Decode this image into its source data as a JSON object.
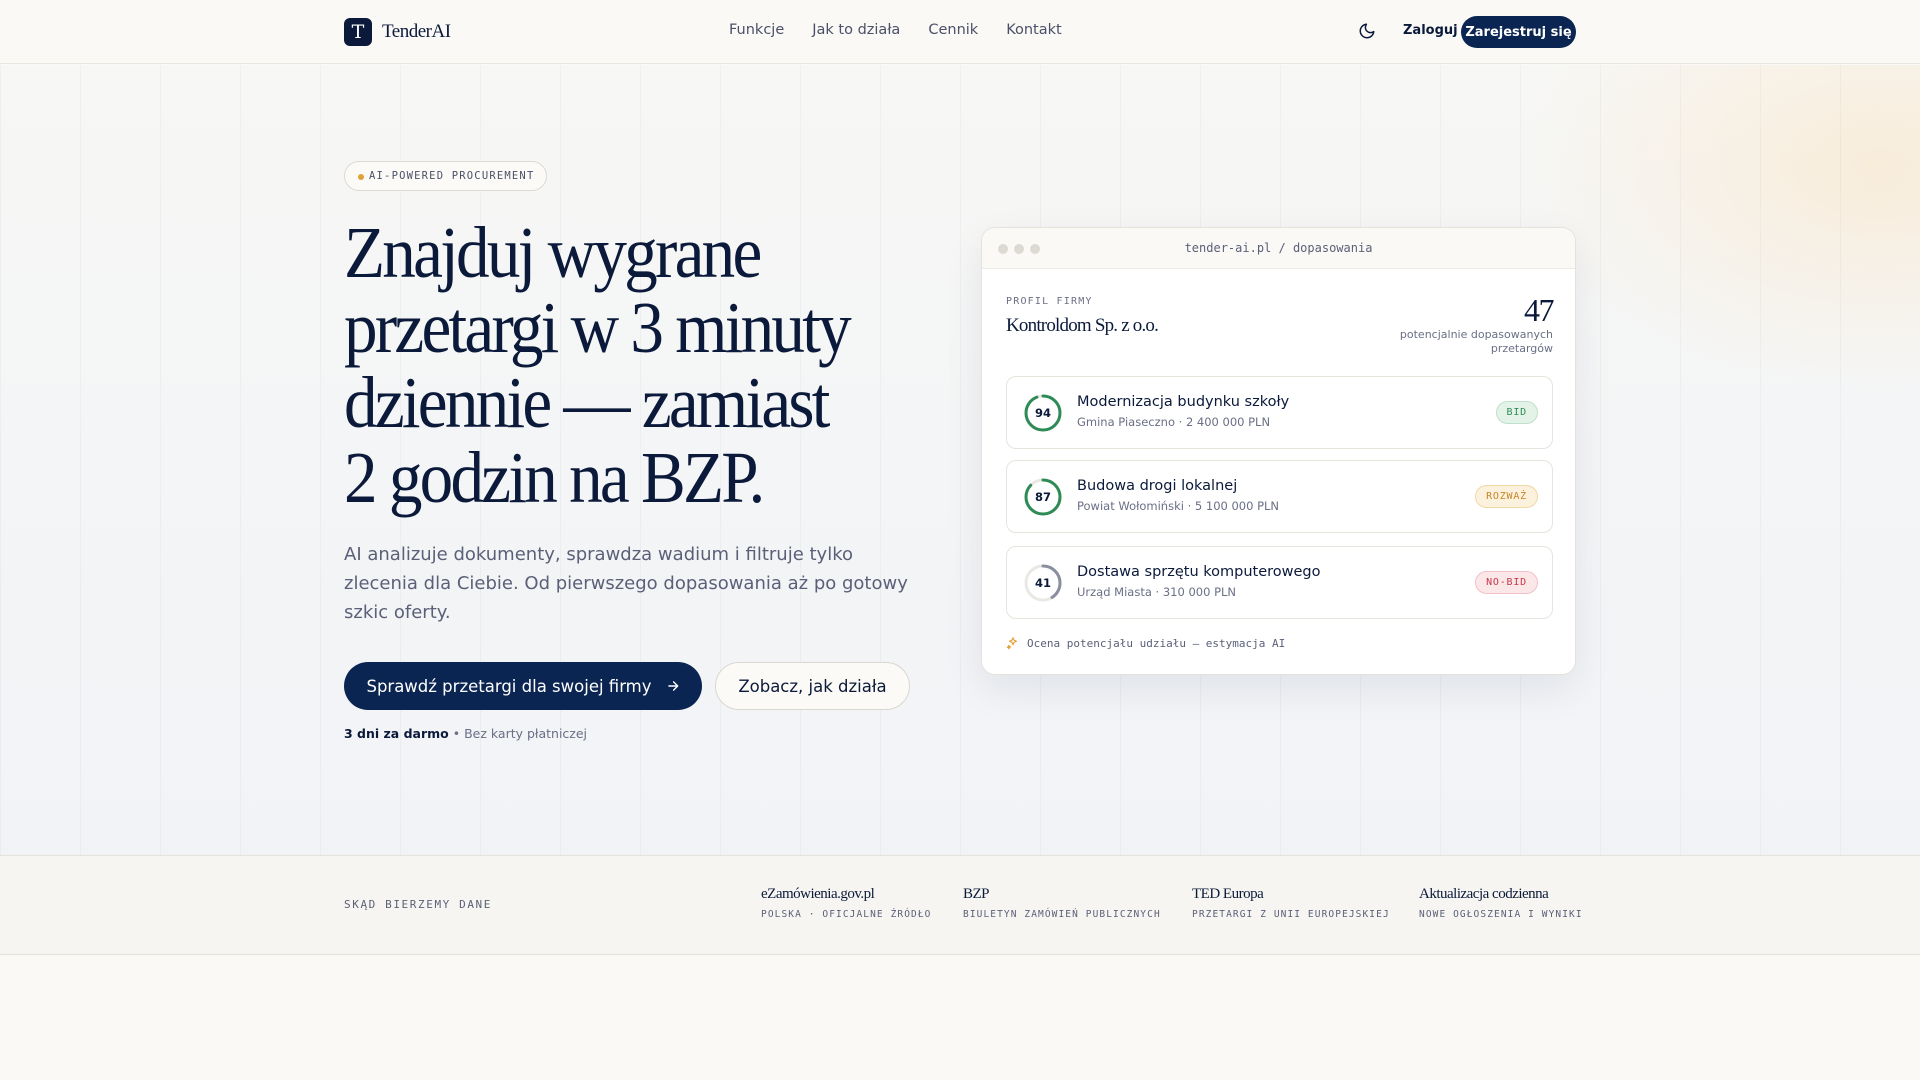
{
  "header": {
    "logo_letter": "T",
    "logo_text": "TenderAI",
    "nav": [
      "Funkcje",
      "Jak to działa",
      "Cennik",
      "Kontakt"
    ],
    "login_label": "Zaloguj",
    "signup_label": "Zarejestruj się"
  },
  "hero": {
    "badge": "AI-POWERED PROCUREMENT",
    "headline": "Znajduj wygrane przetargi w 3 minuty dziennie — zamiast 2 godzin na BZP.",
    "subtext": "AI analizuje dokumenty, sprawdza wadium i filtruje tylko zlecenia dla Ciebie. Od pierwszego dopasowania aż po gotowy szkic oferty.",
    "cta_primary": "Sprawdź przetargi dla swojej firmy",
    "cta_secondary": "Zobacz, jak działa",
    "trial_bold": "3 dni za darmo",
    "trial_rest": "• Bez karty płatniczej"
  },
  "card": {
    "url": "tender-ai.pl / dopasowania",
    "profile_label": "PROFIL FIRMY",
    "profile_name": "Kontroldom Sp. z o.o.",
    "count": "47",
    "count_label": "potencjalnie dopasowanych przetargów",
    "tenders": [
      {
        "score": "94",
        "score_fraction": 0.94,
        "title": "Modernizacja budynku szkoły",
        "sub": "Gmina Piaseczno · 2 400 000 PLN",
        "tag": "BID",
        "ring_color": "#2f8b55"
      },
      {
        "score": "87",
        "score_fraction": 0.87,
        "title": "Budowa drogi lokalnej",
        "sub": "Powiat Wołomiński · 5 100 000 PLN",
        "tag": "ROZWAŻ",
        "ring_color": "#2f8b55"
      },
      {
        "score": "41",
        "score_fraction": 0.41,
        "title": "Dostawa sprzętu komputerowego",
        "sub": "Urząd Miasta · 310 000 PLN",
        "tag": "NO-BID",
        "ring_color": "#8a8f9f"
      }
    ],
    "footer": "Ocena potencjału udziału — estymacja AI"
  },
  "sources": {
    "label": "SKĄD BIERZEMY DANE",
    "items": [
      {
        "name": "eZamówienia.gov.pl",
        "desc": "POLSKA · OFICJALNE ŹRÓDŁO"
      },
      {
        "name": "BZP",
        "desc": "BIULETYN ZAMÓWIEŃ PUBLICZNYCH"
      },
      {
        "name": "TED Europa",
        "desc": "PRZETARGI Z UNII EUROPEJSKIEJ"
      },
      {
        "name": "Aktualizacja codzienna",
        "desc": "NOWE OGŁOSZENIA I WYNIKI"
      }
    ]
  }
}
